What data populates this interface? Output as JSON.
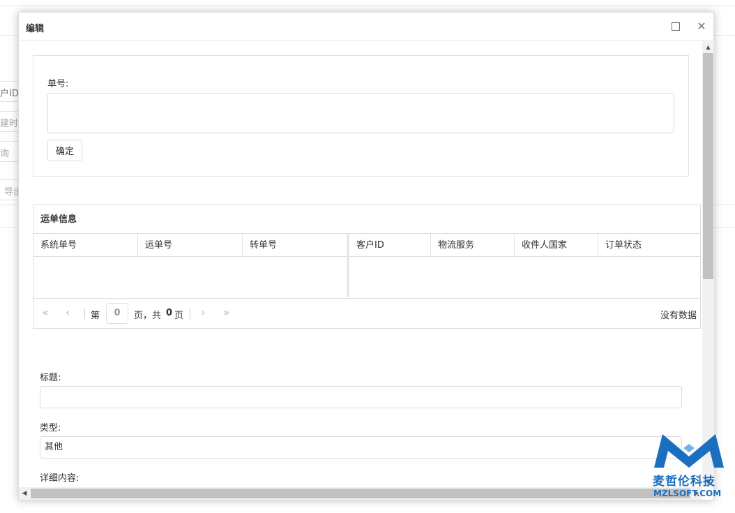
{
  "background": {
    "fragments": [
      "户ID",
      "建时",
      "询",
      "导出"
    ]
  },
  "dialog": {
    "title": "编辑",
    "maximize_icon": "maximize-icon",
    "close_icon": "close-icon",
    "form": {
      "order_label": "单号:",
      "order_value": "",
      "confirm_label": "确定"
    },
    "grid": {
      "title": "运单信息",
      "columns": [
        "系统单号",
        "运单号",
        "转单号",
        "客户ID",
        "物流服务",
        "收件人国家",
        "订单状态"
      ],
      "pager": {
        "page_prefix": "第",
        "page_value": "0",
        "page_suffix": "页，共",
        "total_pages": "0",
        "page_unit": "页",
        "empty_text": "没有数据"
      }
    },
    "title_label": "标题:",
    "title_value": "",
    "type_label": "类型:",
    "type_value": "其他",
    "detail_label": "详细内容:"
  },
  "watermark": {
    "brand_cn": "麦哲伦科技",
    "brand_en": "MZLSOFT.COM",
    "color": "#1a6fc0"
  }
}
